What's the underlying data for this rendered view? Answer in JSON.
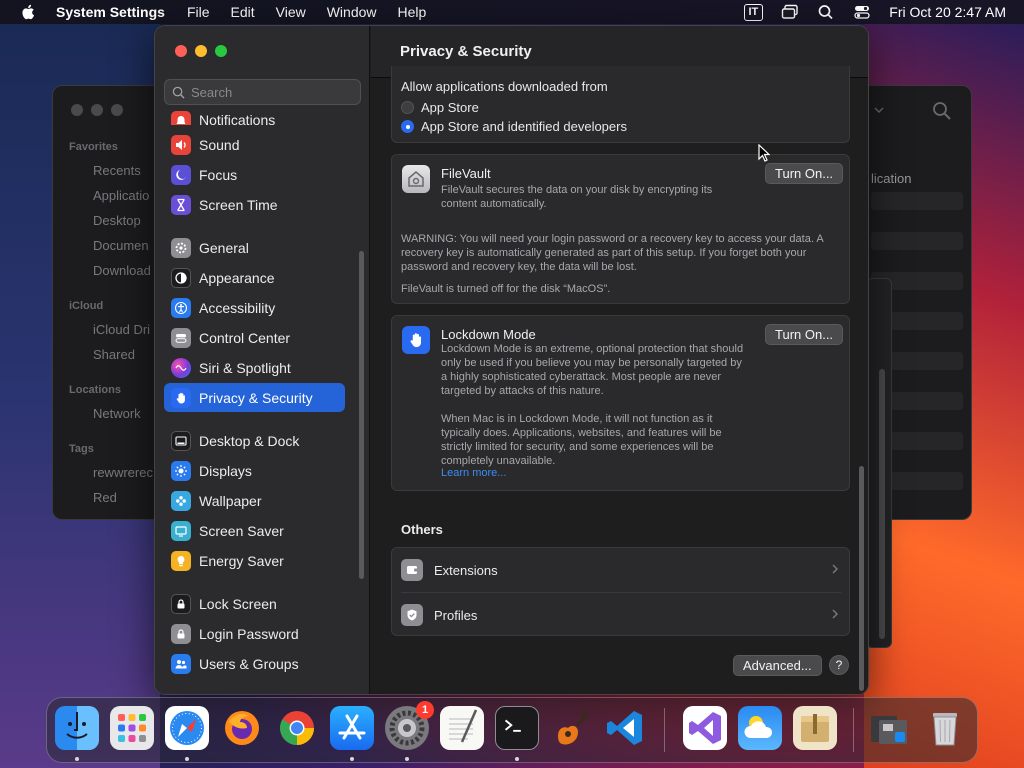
{
  "menubar": {
    "app_name": "System Settings",
    "items": [
      "File",
      "Edit",
      "View",
      "Window",
      "Help"
    ],
    "input_source": "IT",
    "clock": "Fri Oct 20  2:47 AM"
  },
  "finder_bg": {
    "sidebar": {
      "favorites_header": "Favorites",
      "favorites": [
        "Recents",
        "Applicatio",
        "Desktop",
        "Documen",
        "Download"
      ],
      "icloud_header": "iCloud",
      "icloud": [
        "iCloud Dri",
        "Shared"
      ],
      "locations_header": "Locations",
      "locations": [
        "Network"
      ],
      "tags_header": "Tags",
      "tags": [
        "rewwrerec",
        "Red"
      ]
    },
    "column_label": "lication"
  },
  "settings": {
    "search_placeholder": "Search",
    "sidebar": [
      {
        "label": "Notifications",
        "icon": "bell-icon",
        "color": "#e8443a"
      },
      {
        "label": "Sound",
        "icon": "speaker-icon",
        "color": "#e8443a"
      },
      {
        "label": "Focus",
        "icon": "moon-icon",
        "color": "#5b4fd6"
      },
      {
        "label": "Screen Time",
        "icon": "hourglass-icon",
        "color": "#6a4fd6"
      },
      {
        "label": "General",
        "icon": "gear-icon",
        "color": "#8e8e93"
      },
      {
        "label": "Appearance",
        "icon": "appearance-icon",
        "color": "#1c1c1e"
      },
      {
        "label": "Accessibility",
        "icon": "accessibility-icon",
        "color": "#2a7af0"
      },
      {
        "label": "Control Center",
        "icon": "control-center-icon",
        "color": "#8e8e93"
      },
      {
        "label": "Siri & Spotlight",
        "icon": "siri-icon",
        "color": "#c23bd6"
      },
      {
        "label": "Privacy & Security",
        "icon": "hand-icon",
        "color": "#2a6af0"
      },
      {
        "label": "Desktop & Dock",
        "icon": "dock-icon",
        "color": "#1c1c1e"
      },
      {
        "label": "Displays",
        "icon": "sun-icon",
        "color": "#2a7af0"
      },
      {
        "label": "Wallpaper",
        "icon": "flower-icon",
        "color": "#3aa8e0"
      },
      {
        "label": "Screen Saver",
        "icon": "screensaver-icon",
        "color": "#3ab0d0"
      },
      {
        "label": "Energy Saver",
        "icon": "battery-icon",
        "color": "#f5b324"
      },
      {
        "label": "Lock Screen",
        "icon": "lock-icon",
        "color": "#1c1c1e"
      },
      {
        "label": "Login Password",
        "icon": "padlock-icon",
        "color": "#8e8e93"
      },
      {
        "label": "Users & Groups",
        "icon": "users-icon",
        "color": "#2a7af0"
      }
    ],
    "selected": "Privacy & Security",
    "page_title": "Privacy & Security",
    "allow": {
      "title": "Allow applications downloaded from",
      "options": [
        "App Store",
        "App Store and identified developers"
      ],
      "selected_index": 1
    },
    "filevault": {
      "title": "FileVault",
      "description": "FileVault secures the data on your disk by encrypting its content automatically.",
      "warning": "WARNING: You will need your login password or a recovery key to access your data. A recovery key is automatically generated as part of this setup. If you forget both your password and recovery key, the data will be lost.",
      "status": "FileVault is turned off for the disk “MacOS”.",
      "button": "Turn On..."
    },
    "lockdown": {
      "title": "Lockdown Mode",
      "description": "Lockdown Mode is an extreme, optional protection that should only be used if you believe you may be personally targeted by a highly sophisticated cyberattack. Most people are never targeted by attacks of this nature.",
      "description2": "When Mac is in Lockdown Mode, it will not function as it typically does. Applications, websites, and features will be strictly limited for security, and some experiences will be completely unavailable.",
      "link": "Learn more...",
      "button": "Turn On..."
    },
    "others_title": "Others",
    "others": [
      {
        "label": "Extensions",
        "icon": "extensions-icon"
      },
      {
        "label": "Profiles",
        "icon": "profiles-icon"
      }
    ],
    "advanced_button": "Advanced...",
    "help_button": "?"
  },
  "dock": {
    "apps": [
      "Finder",
      "Launchpad",
      "Safari",
      "Firefox",
      "Chrome",
      "App Store",
      "System Settings",
      "TextEdit",
      "Terminal",
      "GarageBand",
      "Visual Studio Code",
      "Visual Studio",
      "Weather",
      "Archive Utility",
      "Downloads",
      "Trash"
    ],
    "settings_badge": "1"
  }
}
